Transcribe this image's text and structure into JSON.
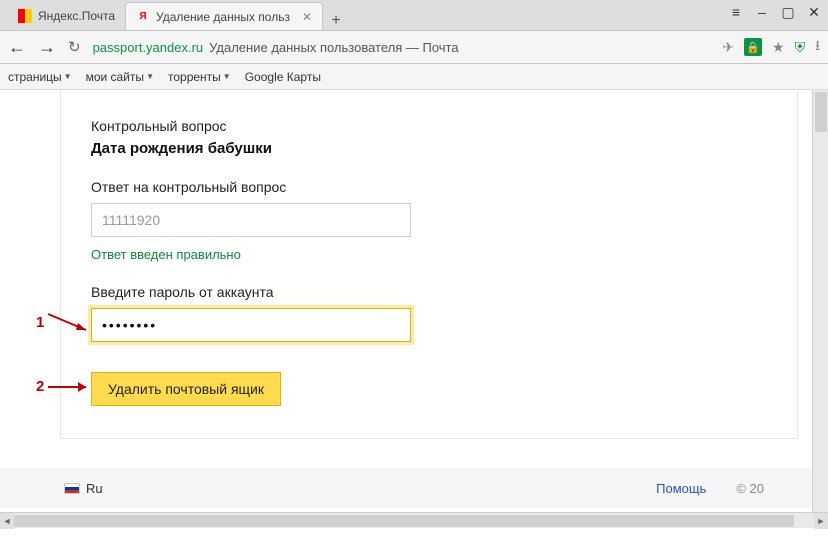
{
  "browser": {
    "tabs": [
      {
        "title": "Яндекс.Почта",
        "active": false
      },
      {
        "title": "Удаление данных польз",
        "active": true
      }
    ],
    "url_host": "passport.yandex.ru",
    "url_title": "Удаление данных пользователя — Почта",
    "bookmarks": [
      "страницы",
      "мои сайты",
      "торренты",
      "Google Карты"
    ]
  },
  "form": {
    "section_label": "Контрольный вопрос",
    "question": "Дата рождения бабушки",
    "answer_label": "Ответ на контрольный вопрос",
    "answer_value": "11111920",
    "ok_message": "Ответ введен правильно",
    "password_label": "Введите пароль от аккаунта",
    "password_value": "••••••••",
    "delete_button": "Удалить почтовый ящик"
  },
  "footer": {
    "lang": "Ru",
    "help": "Помощь",
    "copyright": "© 20"
  },
  "annotations": {
    "one": "1",
    "two": "2"
  },
  "colors": {
    "accent": "#ffdb4d",
    "success": "#0a8a3a",
    "anno": "#c00000"
  }
}
